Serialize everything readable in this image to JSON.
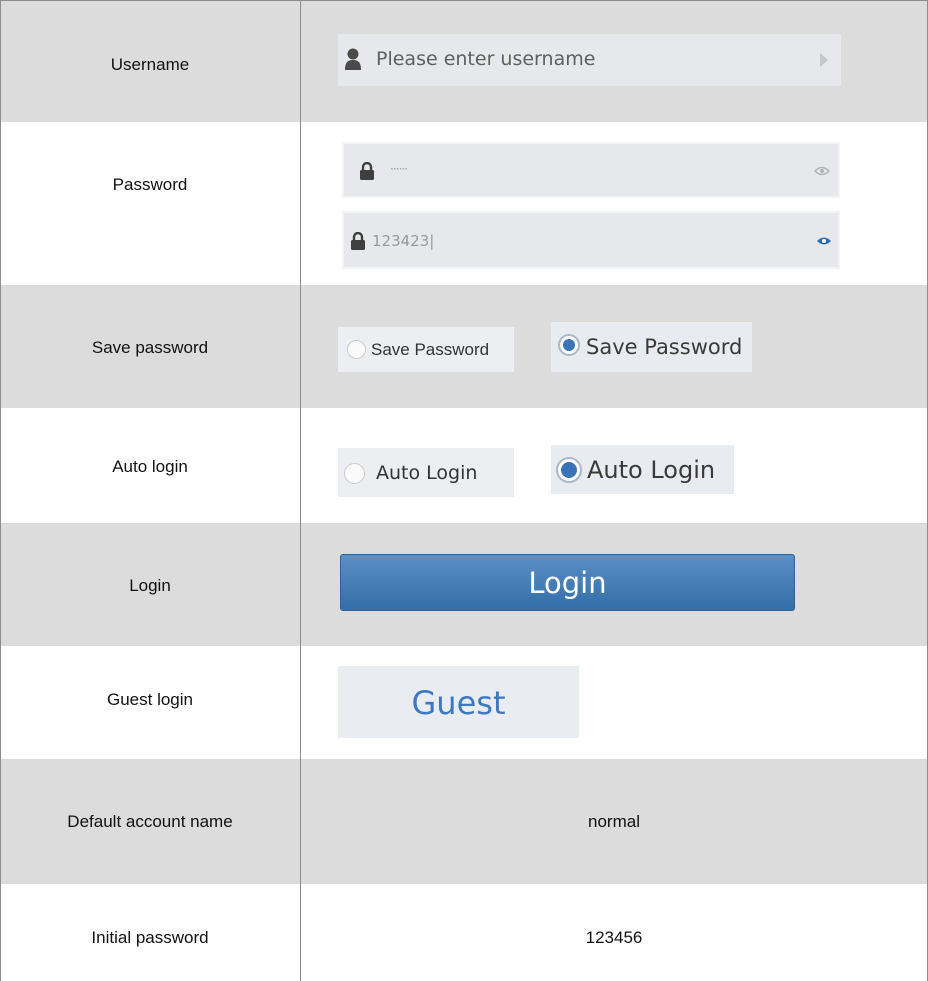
{
  "rows": [
    {
      "label": "Username"
    },
    {
      "label": "Password"
    },
    {
      "label": "Save password"
    },
    {
      "label": "Auto login"
    },
    {
      "label": "Login"
    },
    {
      "label": "Guest login"
    },
    {
      "label": "Default account name"
    },
    {
      "label": "Initial password"
    }
  ],
  "username_field": {
    "placeholder": "Please enter username",
    "icon": "user-icon",
    "arrow_icon": "arrow-right-icon"
  },
  "password_fields": [
    {
      "value": "······",
      "lock_icon": "lock-icon",
      "eye_icon": "eye-icon",
      "revealed": false
    },
    {
      "value": "123423|",
      "lock_icon": "lock-icon",
      "eye_icon": "eye-icon",
      "revealed": true
    }
  ],
  "save_password": {
    "unchecked_label": "Save Password",
    "checked_label": "Save Password"
  },
  "auto_login": {
    "unchecked_label": "Auto Login",
    "checked_label": "Auto Login"
  },
  "login_button": {
    "label": "Login"
  },
  "guest_button": {
    "label": "Guest"
  },
  "default_account_name": "normal",
  "initial_password": "123456",
  "colors": {
    "shade": "#dcdcdc",
    "grid_line": "#8c8c8c",
    "login_blue": "#3f7ab5",
    "guest_text": "#3d79c0",
    "radio_checked": "#3b73b9"
  }
}
